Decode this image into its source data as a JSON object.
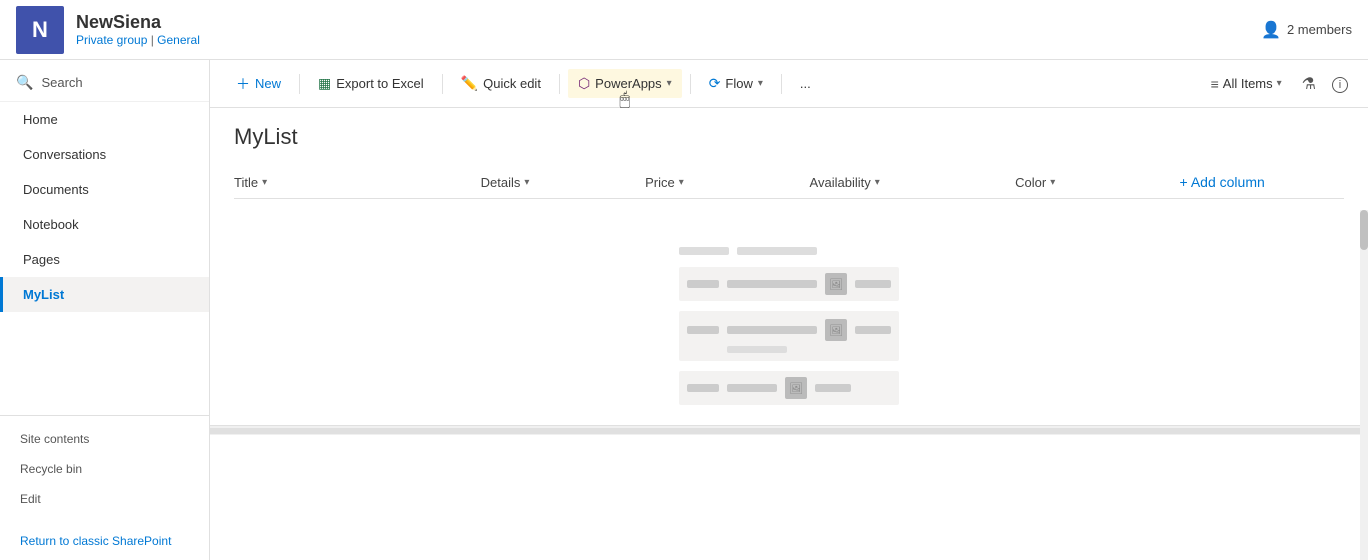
{
  "header": {
    "logo_letter": "N",
    "site_name": "NewSiena",
    "site_private": "Private group",
    "site_general": "General",
    "members_count": "2 members"
  },
  "sidebar": {
    "search_label": "Search",
    "nav_items": [
      {
        "label": "Home",
        "id": "home",
        "active": false
      },
      {
        "label": "Conversations",
        "id": "conversations",
        "active": false
      },
      {
        "label": "Documents",
        "id": "documents",
        "active": false
      },
      {
        "label": "Notebook",
        "id": "notebook",
        "active": false
      },
      {
        "label": "Pages",
        "id": "pages",
        "active": false
      },
      {
        "label": "MyList",
        "id": "mylist",
        "active": true
      }
    ],
    "bottom_items": [
      {
        "label": "Site contents",
        "id": "site-contents"
      },
      {
        "label": "Recycle bin",
        "id": "recycle-bin"
      },
      {
        "label": "Edit",
        "id": "edit"
      }
    ],
    "return_link": "Return to classic SharePoint"
  },
  "toolbar": {
    "new_label": "New",
    "export_label": "Export to Excel",
    "quickedit_label": "Quick edit",
    "powerapps_label": "PowerApps",
    "flow_label": "Flow",
    "more_label": "...",
    "all_items_label": "All Items"
  },
  "list": {
    "title": "MyList",
    "columns": [
      {
        "label": "Title",
        "id": "title"
      },
      {
        "label": "Details",
        "id": "details"
      },
      {
        "label": "Price",
        "id": "price"
      },
      {
        "label": "Availability",
        "id": "availability"
      },
      {
        "label": "Color",
        "id": "color"
      }
    ],
    "add_column_label": "+ Add column"
  },
  "colors": {
    "accent": "#0078d4",
    "logo_bg": "#4052ab",
    "active_border": "#0078d4",
    "powerapps_hover": "#fef8e0"
  }
}
